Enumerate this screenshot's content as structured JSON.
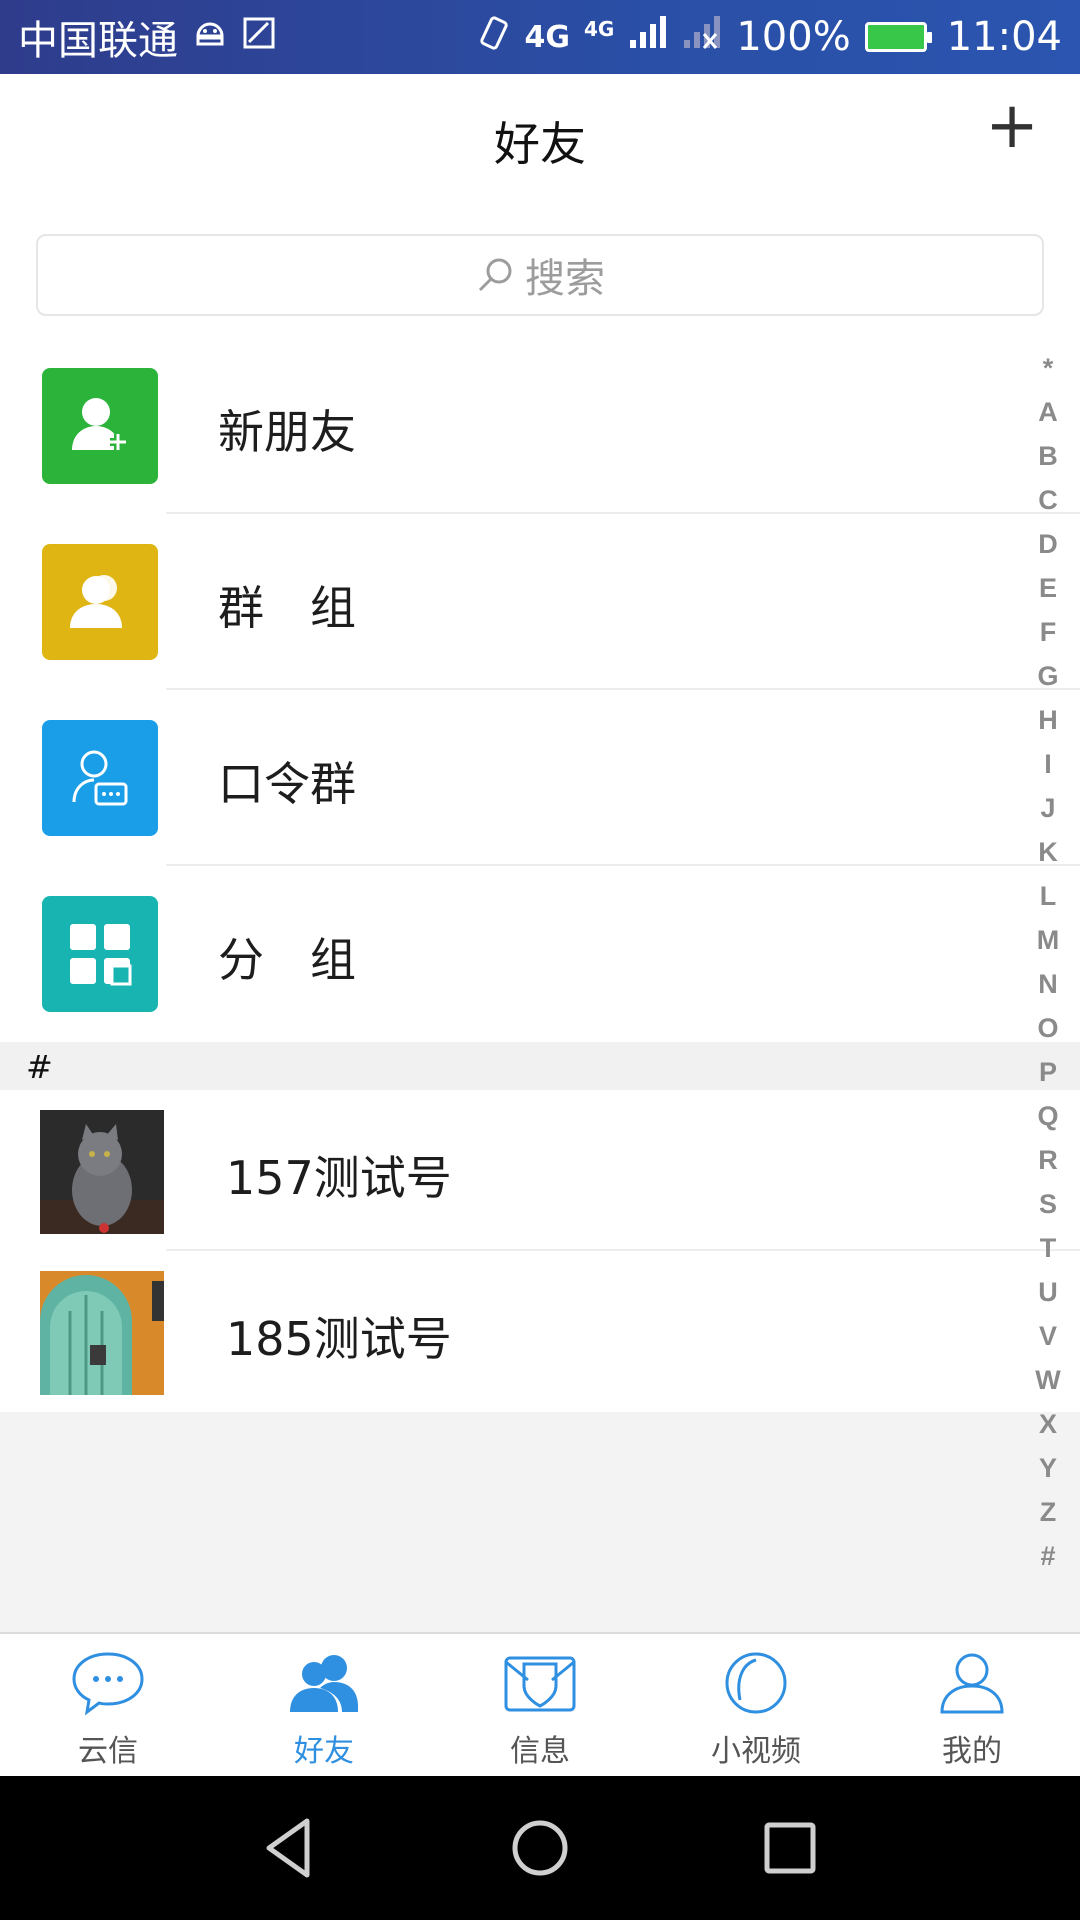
{
  "status_bar": {
    "carrier": "中国联通",
    "network1": "4G",
    "network2": "4G",
    "battery": "100%",
    "time": "11:04"
  },
  "header": {
    "title": "好友",
    "add_label": "+"
  },
  "search": {
    "placeholder": "搜索"
  },
  "features": [
    {
      "label": "新朋友",
      "icon": "new-friend-icon",
      "color": "#2bb33a"
    },
    {
      "label": "群　组",
      "icon": "group-icon",
      "color": "#dfb513"
    },
    {
      "label": "口令群",
      "icon": "password-group-icon",
      "color": "#1a9ee8"
    },
    {
      "label": "分　组",
      "icon": "category-icon",
      "color": "#17b4b2"
    }
  ],
  "section": {
    "header": "#"
  },
  "contacts": [
    {
      "name": "157测试号",
      "avatar": "cat-photo"
    },
    {
      "name": "185测试号",
      "avatar": "door-photo"
    }
  ],
  "index_letters": [
    "*",
    "A",
    "B",
    "C",
    "D",
    "E",
    "F",
    "G",
    "H",
    "I",
    "J",
    "K",
    "L",
    "M",
    "N",
    "O",
    "P",
    "Q",
    "R",
    "S",
    "T",
    "U",
    "V",
    "W",
    "X",
    "Y",
    "Z",
    "#"
  ],
  "tabs": [
    {
      "label": "云信",
      "icon": "chat-bubble-icon",
      "active": false
    },
    {
      "label": "好友",
      "icon": "friends-icon",
      "active": true
    },
    {
      "label": "信息",
      "icon": "message-icon",
      "active": false
    },
    {
      "label": "小视频",
      "icon": "video-icon",
      "active": false
    },
    {
      "label": "我的",
      "icon": "profile-icon",
      "active": false
    }
  ],
  "colors": {
    "accent": "#2f8fe0",
    "status_bar": "#2f3c8c"
  }
}
